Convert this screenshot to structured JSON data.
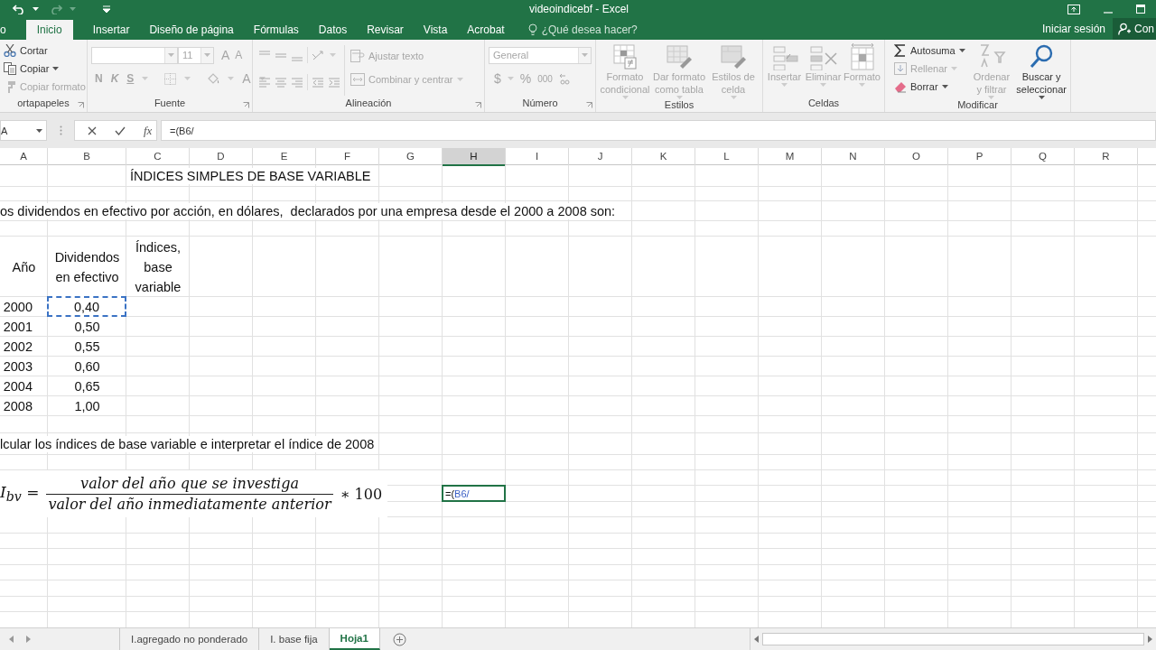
{
  "window": {
    "title": "videoindicebf - Excel"
  },
  "ribbon_tabs": [
    {
      "label": "o",
      "selected": false
    },
    {
      "label": "Inicio",
      "selected": true
    },
    {
      "label": "Insertar",
      "selected": false
    },
    {
      "label": "Diseño de página",
      "selected": false
    },
    {
      "label": "Fórmulas",
      "selected": false
    },
    {
      "label": "Datos",
      "selected": false
    },
    {
      "label": "Revisar",
      "selected": false
    },
    {
      "label": "Vista",
      "selected": false
    },
    {
      "label": "Acrobat",
      "selected": false
    }
  ],
  "tell_me": {
    "placeholder": "¿Qué desea hacer?"
  },
  "account": {
    "sign_in": "Iniciar sesión",
    "share": "Con"
  },
  "ribbon": {
    "groups": [
      {
        "kind": "clipboard",
        "label": "ortapapeles",
        "items": [
          {
            "label": "Cortar",
            "disabled": false
          },
          {
            "label": "Copiar",
            "disabled": false
          },
          {
            "label": "Copiar formato",
            "disabled": true
          }
        ]
      },
      {
        "kind": "font",
        "label": "Fuente",
        "disabled": true,
        "size": "11",
        "styles": [
          "N",
          "K",
          "S"
        ],
        "grow": "A",
        "shrink": "A",
        "font_color": "A"
      },
      {
        "kind": "alignment",
        "label": "Alineación",
        "items": [
          {
            "label": "Ajustar texto",
            "disabled": true
          },
          {
            "label": "Combinar y centrar",
            "disabled": true
          }
        ]
      },
      {
        "kind": "number",
        "label": "Número",
        "disabled": true,
        "format": "General",
        "symbols": [
          "$",
          "%",
          "000"
        ]
      },
      {
        "kind": "styles",
        "label": "Estilos",
        "items": [
          {
            "label": "Formato condicional",
            "disabled": true
          },
          {
            "label": "Dar formato como tabla",
            "disabled": true
          },
          {
            "label": "Estilos de celda",
            "disabled": true
          }
        ]
      },
      {
        "kind": "cells",
        "label": "Celdas",
        "items": [
          {
            "label": "Insertar",
            "disabled": true
          },
          {
            "label": "Eliminar",
            "disabled": true
          },
          {
            "label": "Formato",
            "disabled": true
          }
        ]
      },
      {
        "kind": "editing",
        "label": "Modificar",
        "small": [
          {
            "label": "Autosuma",
            "disabled": false
          },
          {
            "label": "Rellenar",
            "disabled": true
          },
          {
            "label": "Borrar",
            "disabled": false
          }
        ],
        "large": [
          {
            "label": "Ordenar y filtrar",
            "disabled": true
          },
          {
            "label": "Buscar y seleccionar",
            "disabled": false
          }
        ]
      }
    ]
  },
  "formula_bar": {
    "name_box": "A",
    "function_button": "fx",
    "formula": "=(B6/"
  },
  "columns": [
    {
      "label": "A",
      "selected": false
    },
    {
      "label": "B",
      "selected": false
    },
    {
      "label": "C",
      "selected": false
    },
    {
      "label": "D",
      "selected": false
    },
    {
      "label": "E",
      "selected": false
    },
    {
      "label": "F",
      "selected": false
    },
    {
      "label": "G",
      "selected": false
    },
    {
      "label": "H",
      "selected": true
    },
    {
      "label": "I",
      "selected": false
    },
    {
      "label": "J",
      "selected": false
    },
    {
      "label": "K",
      "selected": false
    },
    {
      "label": "L",
      "selected": false
    },
    {
      "label": "M",
      "selected": false
    },
    {
      "label": "N",
      "selected": false
    },
    {
      "label": "O",
      "selected": false
    },
    {
      "label": "P",
      "selected": false
    },
    {
      "label": "Q",
      "selected": false
    },
    {
      "label": "R",
      "selected": false
    }
  ],
  "sheet": {
    "title": "ÍNDICES SIMPLES DE BASE VARIABLE",
    "intro": "os dividendos en efectivo por acción, en dólares,  declarados por una empresa desde el 2000 a 2008 son:",
    "headers": [
      "Año",
      "Dividendos en efectivo",
      "Índices, base variable"
    ],
    "rows": [
      {
        "year": "2000",
        "dividend": "0,40",
        "selected": true
      },
      {
        "year": "2001",
        "dividend": "0,50",
        "selected": false
      },
      {
        "year": "2002",
        "dividend": "0,55",
        "selected": false
      },
      {
        "year": "2003",
        "dividend": "0,60",
        "selected": false
      },
      {
        "year": "2004",
        "dividend": "0,65",
        "selected": false
      },
      {
        "year": "2008",
        "dividend": "1,00",
        "selected": false
      }
    ],
    "task": "lcular los índices de base variable e interpretar el índice de 2008",
    "equation": {
      "lhs": "I$_{bv}$ =",
      "numerator": "valor del año que se investiga",
      "denominator": "valor del año inmediatamente anterior",
      "factor": "∗ 100"
    },
    "editing_cell": {
      "prefix": "=(",
      "reference": "B6/"
    }
  },
  "sheet_tabs": [
    {
      "label": "I.agregado no ponderado",
      "selected": false
    },
    {
      "label": "I. base fija",
      "selected": false
    },
    {
      "label": "Hoja1",
      "selected": true
    }
  ]
}
